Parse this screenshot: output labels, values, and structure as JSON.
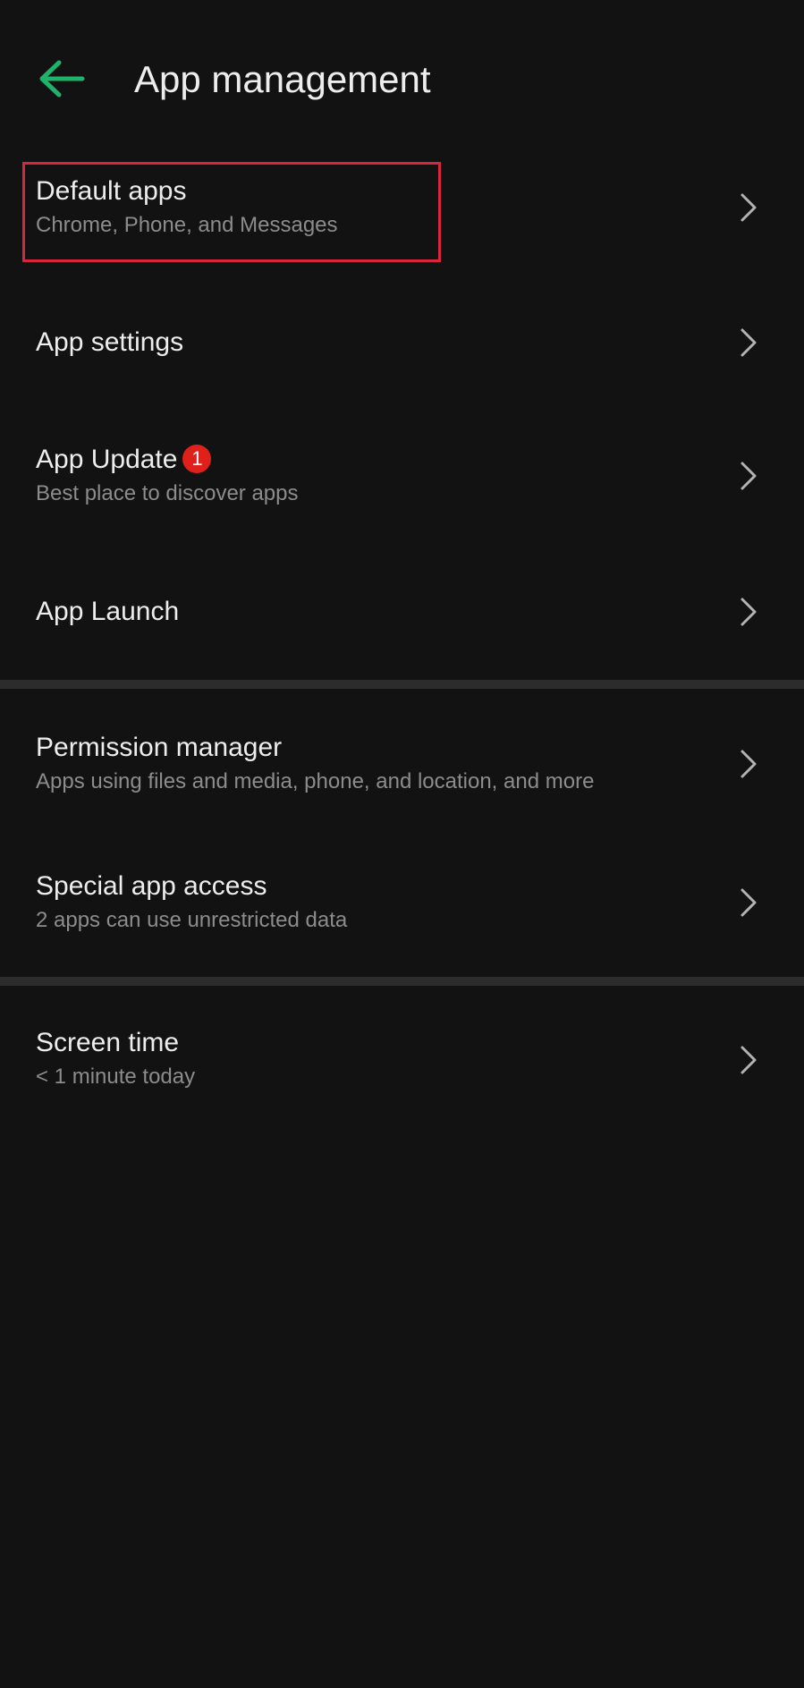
{
  "header": {
    "back_icon": "arrow-left-icon",
    "title": "App management"
  },
  "colors": {
    "background": "#121212",
    "accent": "#1fb26a",
    "badge": "#e0201a",
    "highlight": "#d7263d",
    "divider": "#2c2c2c"
  },
  "items": [
    {
      "title": "Default apps",
      "subtitle": "Chrome, Phone, and Messages"
    },
    {
      "title": "App settings",
      "subtitle": ""
    },
    {
      "title": "App Update",
      "subtitle": "Best place to discover apps",
      "badge": "1"
    },
    {
      "title": "App Launch",
      "subtitle": ""
    },
    {
      "title": "Permission manager",
      "subtitle": "Apps using files and media, phone, and location, and more"
    },
    {
      "title": "Special app access",
      "subtitle": "2 apps can use unrestricted data"
    },
    {
      "title": "Screen time",
      "subtitle": "< 1 minute today"
    }
  ]
}
